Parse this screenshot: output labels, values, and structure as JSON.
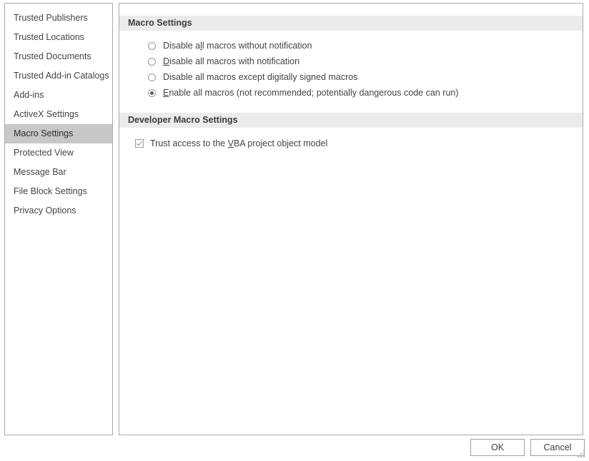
{
  "sidebar": {
    "items": [
      {
        "label": "Trusted Publishers",
        "selected": false
      },
      {
        "label": "Trusted Locations",
        "selected": false
      },
      {
        "label": "Trusted Documents",
        "selected": false
      },
      {
        "label": "Trusted Add-in Catalogs",
        "selected": false
      },
      {
        "label": "Add-ins",
        "selected": false
      },
      {
        "label": "ActiveX Settings",
        "selected": false
      },
      {
        "label": "Macro Settings",
        "selected": true
      },
      {
        "label": "Protected View",
        "selected": false
      },
      {
        "label": "Message Bar",
        "selected": false
      },
      {
        "label": "File Block Settings",
        "selected": false
      },
      {
        "label": "Privacy Options",
        "selected": false
      }
    ]
  },
  "main": {
    "macro_settings": {
      "header": "Macro Settings",
      "options": [
        {
          "label": "Disable all macros without notification",
          "pre": "Disable a",
          "accel": "l",
          "post": "l macros without notification",
          "checked": false
        },
        {
          "label": "Disable all macros with notification",
          "pre": "",
          "accel": "D",
          "post": "isable all macros with notification",
          "checked": false
        },
        {
          "label": "Disable all macros except digitally signed macros",
          "pre": "Disable all macros except di",
          "accel": "g",
          "post": "itally signed macros",
          "checked": false
        },
        {
          "label": "Enable all macros (not recommended; potentially dangerous code can run)",
          "pre": "",
          "accel": "E",
          "post": "nable all macros (not recommended; potentially dangerous code can run)",
          "checked": true
        }
      ]
    },
    "developer_macro_settings": {
      "header": "Developer Macro Settings",
      "option": {
        "label": "Trust access to the VBA project object model",
        "pre": "Trust access to the ",
        "accel": "V",
        "post": "BA project object model",
        "checked": true
      }
    }
  },
  "footer": {
    "ok_label": "OK",
    "cancel_label": "Cancel"
  },
  "colors": {
    "selection": "#c8c8c8",
    "header_band": "#ebebeb",
    "panel_border": "#aaaaaa",
    "text": "#444444"
  }
}
